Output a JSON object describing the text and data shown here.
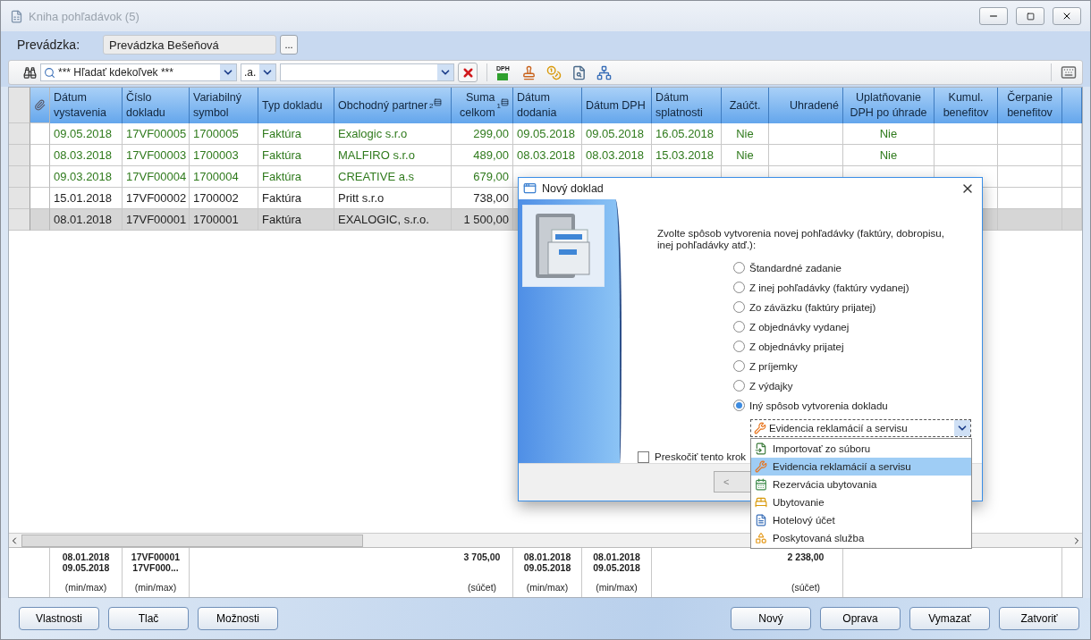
{
  "window": {
    "title": "Kniha pohľadávok (5)"
  },
  "prevadzka": {
    "label": "Prevádzka:",
    "value": "Prevádzka Bešeňová",
    "button": "..."
  },
  "toolbar": {
    "search": {
      "value": "*** Hľadať kdekoľvek ***"
    },
    "mode": {
      "value": ".a."
    },
    "dph_label": "DPH"
  },
  "table": {
    "columns": [
      {
        "label": "Dátum vystavenia"
      },
      {
        "label": "Číslo dokladu"
      },
      {
        "label": "Variabilný symbol"
      },
      {
        "label": "Typ dokladu"
      },
      {
        "label": "Obchodný partner",
        "sort": "2"
      },
      {
        "label": "Suma celkom",
        "sort": "1"
      },
      {
        "label": "Dátum dodania"
      },
      {
        "label": "Dátum DPH"
      },
      {
        "label": "Dátum splatnosti"
      },
      {
        "label": "Zaúčt."
      },
      {
        "label": "Uhradené"
      },
      {
        "label": "Uplatňovanie DPH po úhrade"
      },
      {
        "label": "Kumul. benefitov"
      },
      {
        "label": "Čerpanie benefitov"
      }
    ],
    "rows": [
      {
        "cells": [
          "09.05.2018",
          "17VF00005",
          "1700005",
          "Faktúra",
          "Exalogic s.r.o",
          "299,00",
          "09.05.2018",
          "09.05.2018",
          "16.05.2018",
          "Nie",
          "",
          "Nie"
        ],
        "color": "#2f7a1c",
        "selected": false
      },
      {
        "cells": [
          "08.03.2018",
          "17VF00003",
          "1700003",
          "Faktúra",
          "MALFIRO s.r.o",
          "489,00",
          "08.03.2018",
          "08.03.2018",
          "15.03.2018",
          "Nie",
          "",
          "Nie"
        ],
        "color": "#2f7a1c",
        "selected": false
      },
      {
        "cells": [
          "09.03.2018",
          "17VF00004",
          "1700004",
          "Faktúra",
          "CREATIVE a.s",
          "679,00"
        ],
        "color": "#2f7a1c",
        "selected": false
      },
      {
        "cells": [
          "15.01.2018",
          "17VF00002",
          "1700002",
          "Faktúra",
          "Pritt s.r.o",
          "738,00"
        ],
        "color": "#1e1e1e",
        "selected": false
      },
      {
        "cells": [
          "08.01.2018",
          "17VF00001",
          "1700001",
          "Faktúra",
          "EXALOGIC, s.r.o.",
          "1 500,00"
        ],
        "color": "#1e1e1e",
        "selected": true
      }
    ]
  },
  "summary": [
    {
      "kind": "stat",
      "lines": [
        "08.01.2018",
        "09.05.2018"
      ],
      "note": "(min/max)"
    },
    {
      "kind": "stat",
      "lines": [
        "17VF00001",
        "17VF000..."
      ],
      "note": "(min/max)"
    },
    {
      "kind": "blank"
    },
    {
      "kind": "blank"
    },
    {
      "kind": "blank"
    },
    {
      "kind": "stat",
      "lines": [
        "3 705,00"
      ],
      "note": "(súčet)"
    },
    {
      "kind": "stat",
      "lines": [
        "08.01.2018",
        "09.05.2018"
      ],
      "note": "(min/max)"
    },
    {
      "kind": "stat",
      "lines": [
        "08.01.2018",
        "09.05.2018"
      ],
      "note": "(min/max)"
    },
    {
      "kind": "blank"
    },
    {
      "kind": "blank"
    },
    {
      "kind": "stat",
      "lines": [
        "2 238,00"
      ],
      "note": "(súčet)"
    },
    {
      "kind": "blank"
    },
    {
      "kind": "blank"
    },
    {
      "kind": "blank"
    }
  ],
  "buttons": {
    "left": [
      "Vlastnosti",
      "Tlač",
      "Možnosti"
    ],
    "right": [
      "Nový",
      "Oprava",
      "Vymazať",
      "Zatvoriť"
    ]
  },
  "dialog": {
    "title": "Nový doklad",
    "prompt": "Zvolte spôsob vytvorenia novej pohľadávky (faktúry, dobropisu, inej pohľadávky atď.):",
    "options": [
      {
        "label": "Štandardné zadanie",
        "selected": false
      },
      {
        "label": "Z inej pohľadávky (faktúry vydanej)",
        "selected": false
      },
      {
        "label": "Zo záväzku (faktúry prijatej)",
        "selected": false
      },
      {
        "label": "Z objednávky vydanej",
        "selected": false
      },
      {
        "label": "Z objednávky prijatej",
        "selected": false
      },
      {
        "label": "Z príjemky",
        "selected": false
      },
      {
        "label": "Z výdajky",
        "selected": false
      },
      {
        "label": "Iný spôsob vytvorenia dokladu",
        "selected": true
      }
    ],
    "method": {
      "value": "Evidencia reklamácií a servisu",
      "items": [
        {
          "label": "Importovať zo súboru",
          "kind": "import",
          "selected": false
        },
        {
          "label": "Evidencia reklamácií a servisu",
          "kind": "service",
          "selected": true
        },
        {
          "label": "Rezervácia ubytovania",
          "kind": "booking",
          "selected": false
        },
        {
          "label": "Ubytovanie",
          "kind": "bed",
          "selected": false
        },
        {
          "label": "Hotelový účet",
          "kind": "bill",
          "selected": false
        },
        {
          "label": "Poskytovaná služba",
          "kind": "shapes",
          "selected": false
        }
      ]
    },
    "skip": {
      "label": "Preskočiť tento krok",
      "checked": false
    },
    "back_button": "<"
  }
}
